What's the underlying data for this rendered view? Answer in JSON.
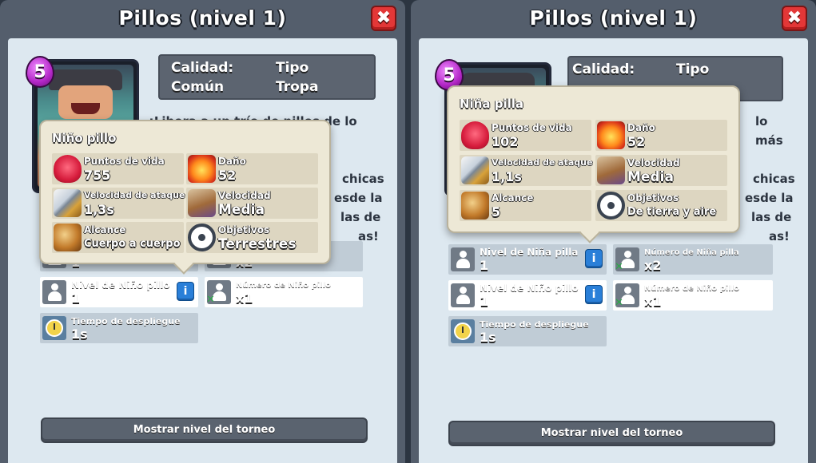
{
  "left": {
    "title": "Pillos (nivel 1)",
    "elixir": "5",
    "quality_label": "Calidad:",
    "quality_value": "Común",
    "type_label": "Tipo",
    "type_value": "Tropa",
    "desc_lines": [
      "¡Libera a un trío de pillos de lo más",
      "la",
      "chicas",
      "esde la",
      "las de",
      "as!"
    ],
    "popup": {
      "title": "Niño pillo",
      "stats": [
        {
          "icon": "heart-icon",
          "name": "Puntos de vida",
          "value": "755"
        },
        {
          "icon": "damage-icon",
          "name": "Daño",
          "value": "52"
        },
        {
          "icon": "sword-icon",
          "name": "Velocidad de ataque",
          "value": "1,3s"
        },
        {
          "icon": "speed-icon",
          "name": "Velocidad",
          "value": "Media"
        },
        {
          "icon": "bow-icon",
          "name": "Alcance",
          "value": "Cuerpo a cuerpo"
        },
        {
          "icon": "target-icon",
          "name": "Objetivos",
          "value": "Terrestres"
        }
      ]
    },
    "rows": {
      "top_left_value": "1",
      "top_right_value": "x2",
      "level_title": "Nivel de Niño pillo",
      "level_value": "1",
      "count_title": "Número de Niño pillo",
      "count_value": "x1",
      "deploy_title": "Tiempo de despliegue",
      "deploy_value": "1s"
    },
    "tourney_label": "Mostrar nivel del torneo"
  },
  "right": {
    "title": "Pillos (nivel 1)",
    "elixir": "5",
    "quality_label": "Calidad:",
    "type_label": "Tipo",
    "desc_lines": [
      "lo más",
      "la",
      "chicas",
      "esde la",
      "las de",
      "as!"
    ],
    "popup": {
      "title": "Niña pilla",
      "stats": [
        {
          "icon": "heart-icon",
          "name": "Puntos de vida",
          "value": "102"
        },
        {
          "icon": "damage-icon",
          "name": "Daño",
          "value": "52"
        },
        {
          "icon": "sword-icon",
          "name": "Velocidad de ataque",
          "value": "1,1s"
        },
        {
          "icon": "speed-icon",
          "name": "Velocidad",
          "value": "Media"
        },
        {
          "icon": "bow-icon",
          "name": "Alcance",
          "value": "5"
        },
        {
          "icon": "target-icon",
          "name": "Objetivos",
          "value": "De tierra y aire"
        }
      ]
    },
    "rows": {
      "level1_title": "Nivel de Niña pilla",
      "level1_value": "1",
      "count1_title": "Número de Niña pilla",
      "count1_value": "x2",
      "level2_title": "Nivel de Niño pillo",
      "level2_value": "1",
      "count2_title": "Número de Niño pillo",
      "count2_value": "x1",
      "deploy_title": "Tiempo de despliegue",
      "deploy_value": "1s"
    },
    "tourney_label": "Mostrar nivel del torneo"
  },
  "close_label": "✖"
}
